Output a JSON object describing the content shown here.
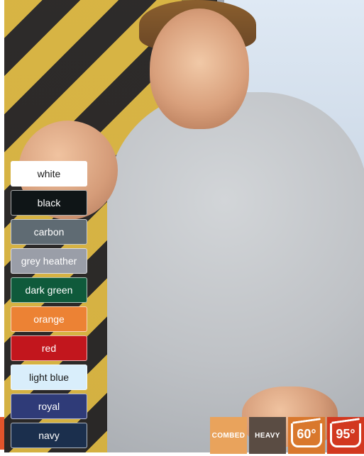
{
  "colors": [
    {
      "label": "white",
      "bg": "#ffffff",
      "fg": "#1a1a1a"
    },
    {
      "label": "black",
      "bg": "#0f1517",
      "fg": "#ffffff"
    },
    {
      "label": "carbon",
      "bg": "#5f6b73",
      "fg": "#ffffff"
    },
    {
      "label": "grey heather",
      "bg": "#9a9ea8",
      "fg": "#ffffff"
    },
    {
      "label": "dark green",
      "bg": "#0f5a3b",
      "fg": "#ffffff"
    },
    {
      "label": "orange",
      "bg": "#ec8234",
      "fg": "#ffffff"
    },
    {
      "label": "red",
      "bg": "#c2161d",
      "fg": "#ffffff"
    },
    {
      "label": "light blue",
      "bg": "#d9eefb",
      "fg": "#1a1a1a"
    },
    {
      "label": "royal",
      "bg": "#2f3b78",
      "fg": "#ffffff"
    },
    {
      "label": "navy",
      "bg": "#1b2f4d",
      "fg": "#ffffff"
    }
  ],
  "badges": {
    "combed": {
      "label": "COMBED",
      "bg": "#e9a35c"
    },
    "heavy": {
      "label": "HEAVY",
      "bg": "#5a4c43"
    },
    "wash60": {
      "label": "60°",
      "bg": "#d9782d"
    },
    "wash95": {
      "label": "95°",
      "bg": "#d2381f"
    }
  }
}
